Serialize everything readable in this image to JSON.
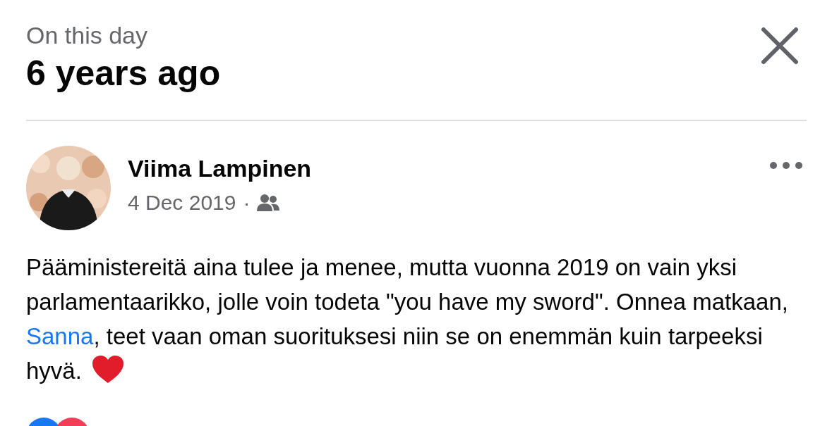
{
  "header": {
    "subtitle": "On this day",
    "title": "6 years ago"
  },
  "post": {
    "author": "Viima Lampinen",
    "date": "4 Dec 2019",
    "separator": "·",
    "text_parts": [
      {
        "kind": "text",
        "text": "Pääministereitä aina tulee ja menee, mutta vuonna 2019 on vain yksi parlamentaarikko, jolle voin todeta \"you have my sword\". Onnea matkaan, "
      },
      {
        "kind": "link",
        "text": "Sanna"
      },
      {
        "kind": "text",
        "text": ", teet vaan oman suorituksesi niin se on enemmän kuin tarpeeksi hyvä."
      }
    ]
  }
}
